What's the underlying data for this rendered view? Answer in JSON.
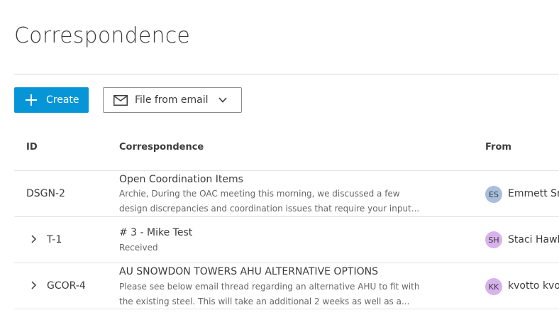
{
  "page": {
    "title": "Correspondence"
  },
  "toolbar": {
    "create_label": "Create",
    "email_label": "File from email"
  },
  "table": {
    "columns": [
      "ID",
      "Correspondence",
      "From"
    ],
    "rows": [
      {
        "id": "DSGN-2",
        "subject": "Open Coordination Items",
        "snippet_line1": "Archie, During the OAC meeting this morning, we discussed a few",
        "snippet_line2": "design discrepancies and coordination issues that require your input...",
        "from_initials": "ES",
        "from_name": "Emmett Sm",
        "avatar_color": "#a9bedc"
      },
      {
        "id": "T-1",
        "subject": "# 3 - Mike Test",
        "snippet_line1": "Received",
        "from_initials": "SH",
        "from_name": "Staci Hawk",
        "avatar_color": "#d7b2ec"
      },
      {
        "id": "GCOR-4",
        "subject": "AU SNOWDON TOWERS AHU ALTERNATIVE OPTIONS",
        "snippet_line1": "Please see below email thread regarding an alternative AHU to fit with",
        "snippet_line2": "the existing steel. This will take an additional 2 weeks as well as a...",
        "from_initials": "KK",
        "from_name": "kvotto kvo",
        "avatar_color": "#d7b2ec"
      }
    ]
  },
  "colors": {
    "primary": "#0696d7",
    "text": "#3c3c3c"
  },
  "icons": [
    "plus-icon",
    "mail-icon",
    "chevron-down-icon",
    "chevron-right-icon"
  ]
}
